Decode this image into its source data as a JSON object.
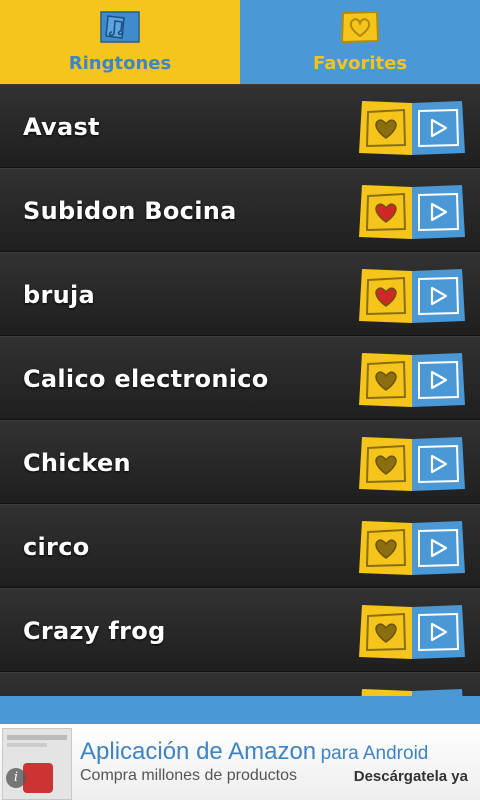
{
  "tabs": [
    {
      "label": "Ringtones",
      "icon": "ringtones-icon",
      "active": true
    },
    {
      "label": "Favorites",
      "icon": "heart-icon",
      "active": false
    }
  ],
  "list": {
    "items": [
      {
        "title": "Avast",
        "favorite": false
      },
      {
        "title": "Subidon Bocina",
        "favorite": true
      },
      {
        "title": "bruja",
        "favorite": true
      },
      {
        "title": "Calico electronico",
        "favorite": false
      },
      {
        "title": "Chicken",
        "favorite": false
      },
      {
        "title": "circo",
        "favorite": false
      },
      {
        "title": "Crazy frog",
        "favorite": false
      },
      {
        "title": "",
        "favorite": false
      }
    ]
  },
  "ad": {
    "title_big": "Aplicación de Amazon",
    "title_small": "para Android",
    "subtitle": "Compra millones de productos",
    "cta": "Descárgatela ya",
    "info_icon": "i"
  },
  "colors": {
    "yellow": "#f6c51b",
    "blue": "#4b98d6",
    "heart_on": "#d02828",
    "heart_off": "#8a6e10"
  }
}
